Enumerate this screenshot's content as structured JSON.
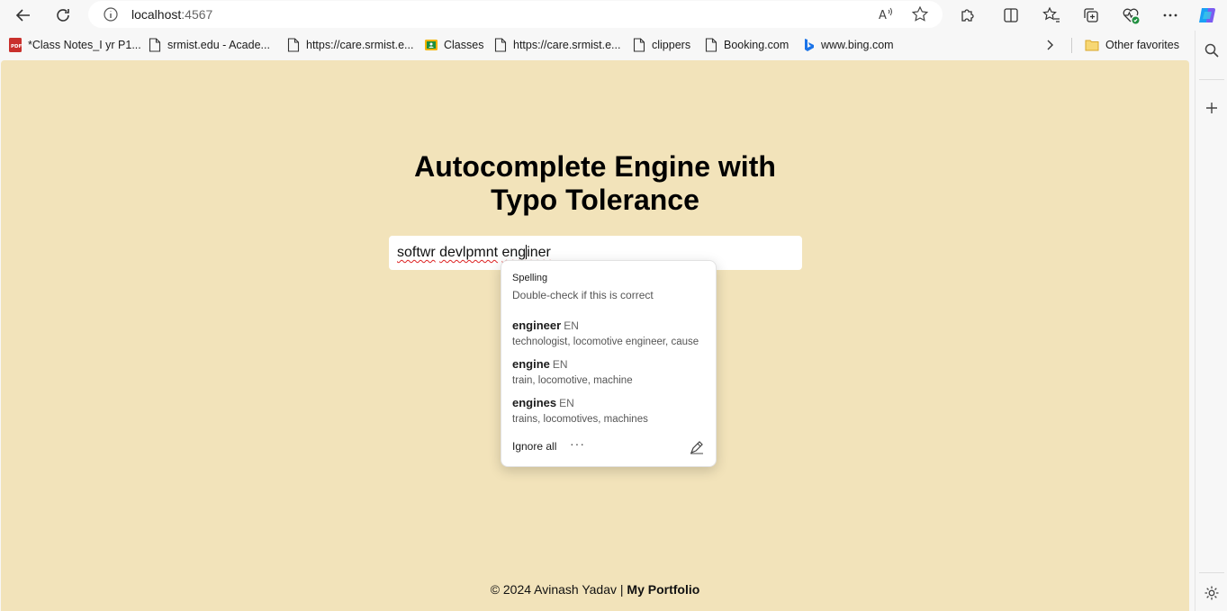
{
  "browser": {
    "url_host": "localhost",
    "url_port": ":4567"
  },
  "bookmarks": [
    {
      "label": "*Class Notes_I yr P1...",
      "icon": "pdf-icon"
    },
    {
      "label": "srmist.edu - Acade...",
      "icon": "page-icon"
    },
    {
      "label": "https://care.srmist.e...",
      "icon": "page-icon"
    },
    {
      "label": "Classes",
      "icon": "classroom-icon"
    },
    {
      "label": "https://care.srmist.e...",
      "icon": "page-icon"
    },
    {
      "label": "clippers",
      "icon": "page-icon"
    },
    {
      "label": "Booking.com",
      "icon": "page-icon"
    },
    {
      "label": "www.bing.com",
      "icon": "bing-icon"
    }
  ],
  "other_favorites": "Other favorites",
  "page": {
    "title_line1": "Autocomplete Engine with",
    "title_line2": "Typo Tolerance",
    "search_value_part1": "softwr",
    "search_value_part2": "devlpmnt",
    "search_value_part3a": "eng",
    "search_value_part3b": "iner",
    "footer_prefix": "© 2024 Avinash Yadav | ",
    "footer_link": "My Portfolio"
  },
  "spelling_popup": {
    "heading": "Spelling",
    "subheading": "Double-check if this is correct",
    "suggestions": [
      {
        "word": "engineer",
        "lang": "EN",
        "synonyms": "technologist, locomotive engineer, cause"
      },
      {
        "word": "engine",
        "lang": "EN",
        "synonyms": "train, locomotive, machine"
      },
      {
        "word": "engines",
        "lang": "EN",
        "synonyms": "trains, locomotives, machines"
      }
    ],
    "ignore_all": "Ignore all",
    "more": "···"
  },
  "colors": {
    "page_background": "#f2e3ba",
    "browser_chrome": "#f7f7f7"
  }
}
